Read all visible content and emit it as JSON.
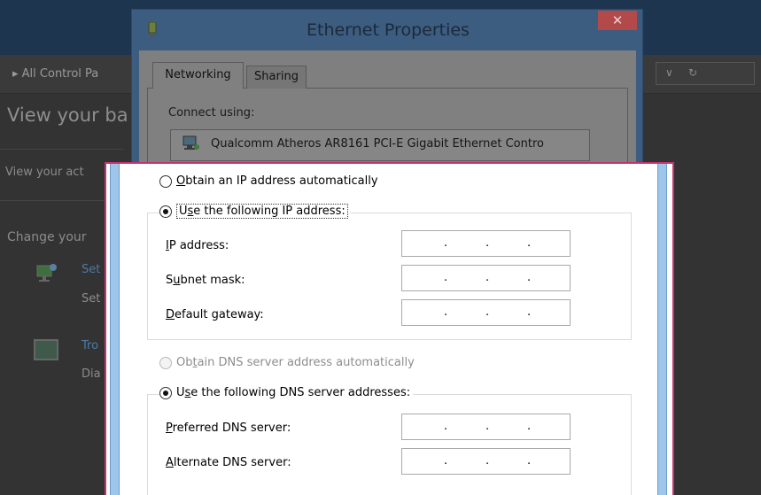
{
  "background_window": {
    "address_bar": {
      "path": "▸  All Control Pa"
    },
    "heading": "View your ba",
    "section1": "View your act",
    "section2": "Change your",
    "items": [
      {
        "title": "Set",
        "desc": "Set"
      },
      {
        "title": "Tro",
        "desc": "Dia"
      }
    ]
  },
  "ethernet_dialog": {
    "title": "Ethernet Properties",
    "close_glyph": "✕",
    "tabs": [
      {
        "label": "Networking",
        "active": true
      },
      {
        "label": "Sharing",
        "active": false
      }
    ],
    "connect_using_label": "Connect using:",
    "adapter_name": "Qualcomm Atheros AR8161 PCI-E Gigabit Ethernet Contro"
  },
  "ipv4_dialog": {
    "ip_options": [
      {
        "label": "Obtain an IP address automatically",
        "mnemonic_index": 0,
        "selected": false
      },
      {
        "label": "Use the following IP address:",
        "mnemonic_index": 1,
        "selected": true
      }
    ],
    "ip_fields": [
      {
        "label": "IP address:",
        "mnemonic_index": 0,
        "value": ". . ."
      },
      {
        "label": "Subnet mask:",
        "mnemonic_index": 1,
        "value": ". . ."
      },
      {
        "label": "Default gateway:",
        "mnemonic_index": 0,
        "value": ". . ."
      }
    ],
    "dns_options": [
      {
        "label": "Obtain DNS server address automatically",
        "mnemonic_index": 2,
        "selected": false,
        "disabled": true
      },
      {
        "label": "Use the following DNS server addresses:",
        "mnemonic_index": 1,
        "selected": true,
        "disabled": false
      }
    ],
    "dns_fields": [
      {
        "label": "Preferred DNS server:",
        "mnemonic_index": 0,
        "value": ". . ."
      },
      {
        "label": "Alternate DNS server:",
        "mnemonic_index": 0,
        "value": ". . ."
      }
    ]
  },
  "colors": {
    "highlight_border": "#c3326c",
    "side_strip": "#9ec5ea"
  }
}
